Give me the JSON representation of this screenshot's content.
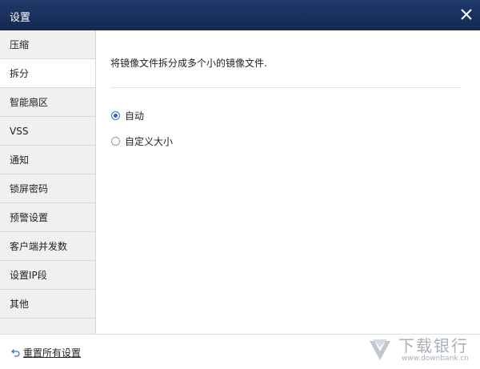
{
  "window": {
    "title": "设置",
    "close_icon": "close-icon"
  },
  "sidebar": {
    "items": [
      {
        "label": "压缩",
        "active": false
      },
      {
        "label": "拆分",
        "active": true
      },
      {
        "label": "智能扇区",
        "active": false
      },
      {
        "label": "VSS",
        "active": false
      },
      {
        "label": "通知",
        "active": false
      },
      {
        "label": "锁屏密码",
        "active": false
      },
      {
        "label": "预警设置",
        "active": false
      },
      {
        "label": "客户端并发数",
        "active": false
      },
      {
        "label": "设置IP段",
        "active": false
      },
      {
        "label": "其他",
        "active": false
      }
    ]
  },
  "content": {
    "description": "将镜像文件拆分成多个小的镜像文件.",
    "options": [
      {
        "label": "自动",
        "checked": true
      },
      {
        "label": "自定义大小",
        "checked": false
      }
    ]
  },
  "footer": {
    "reset_label": "重置所有设置",
    "reset_icon": "undo-icon"
  },
  "watermark": {
    "text": "下载银行",
    "url_text": "www.downbank.cn",
    "icon": "downbank-logo"
  },
  "colors": {
    "titlebar": "#1a335f",
    "accent": "#2f66c9",
    "sidebar_bg": "#f0f0f0"
  }
}
